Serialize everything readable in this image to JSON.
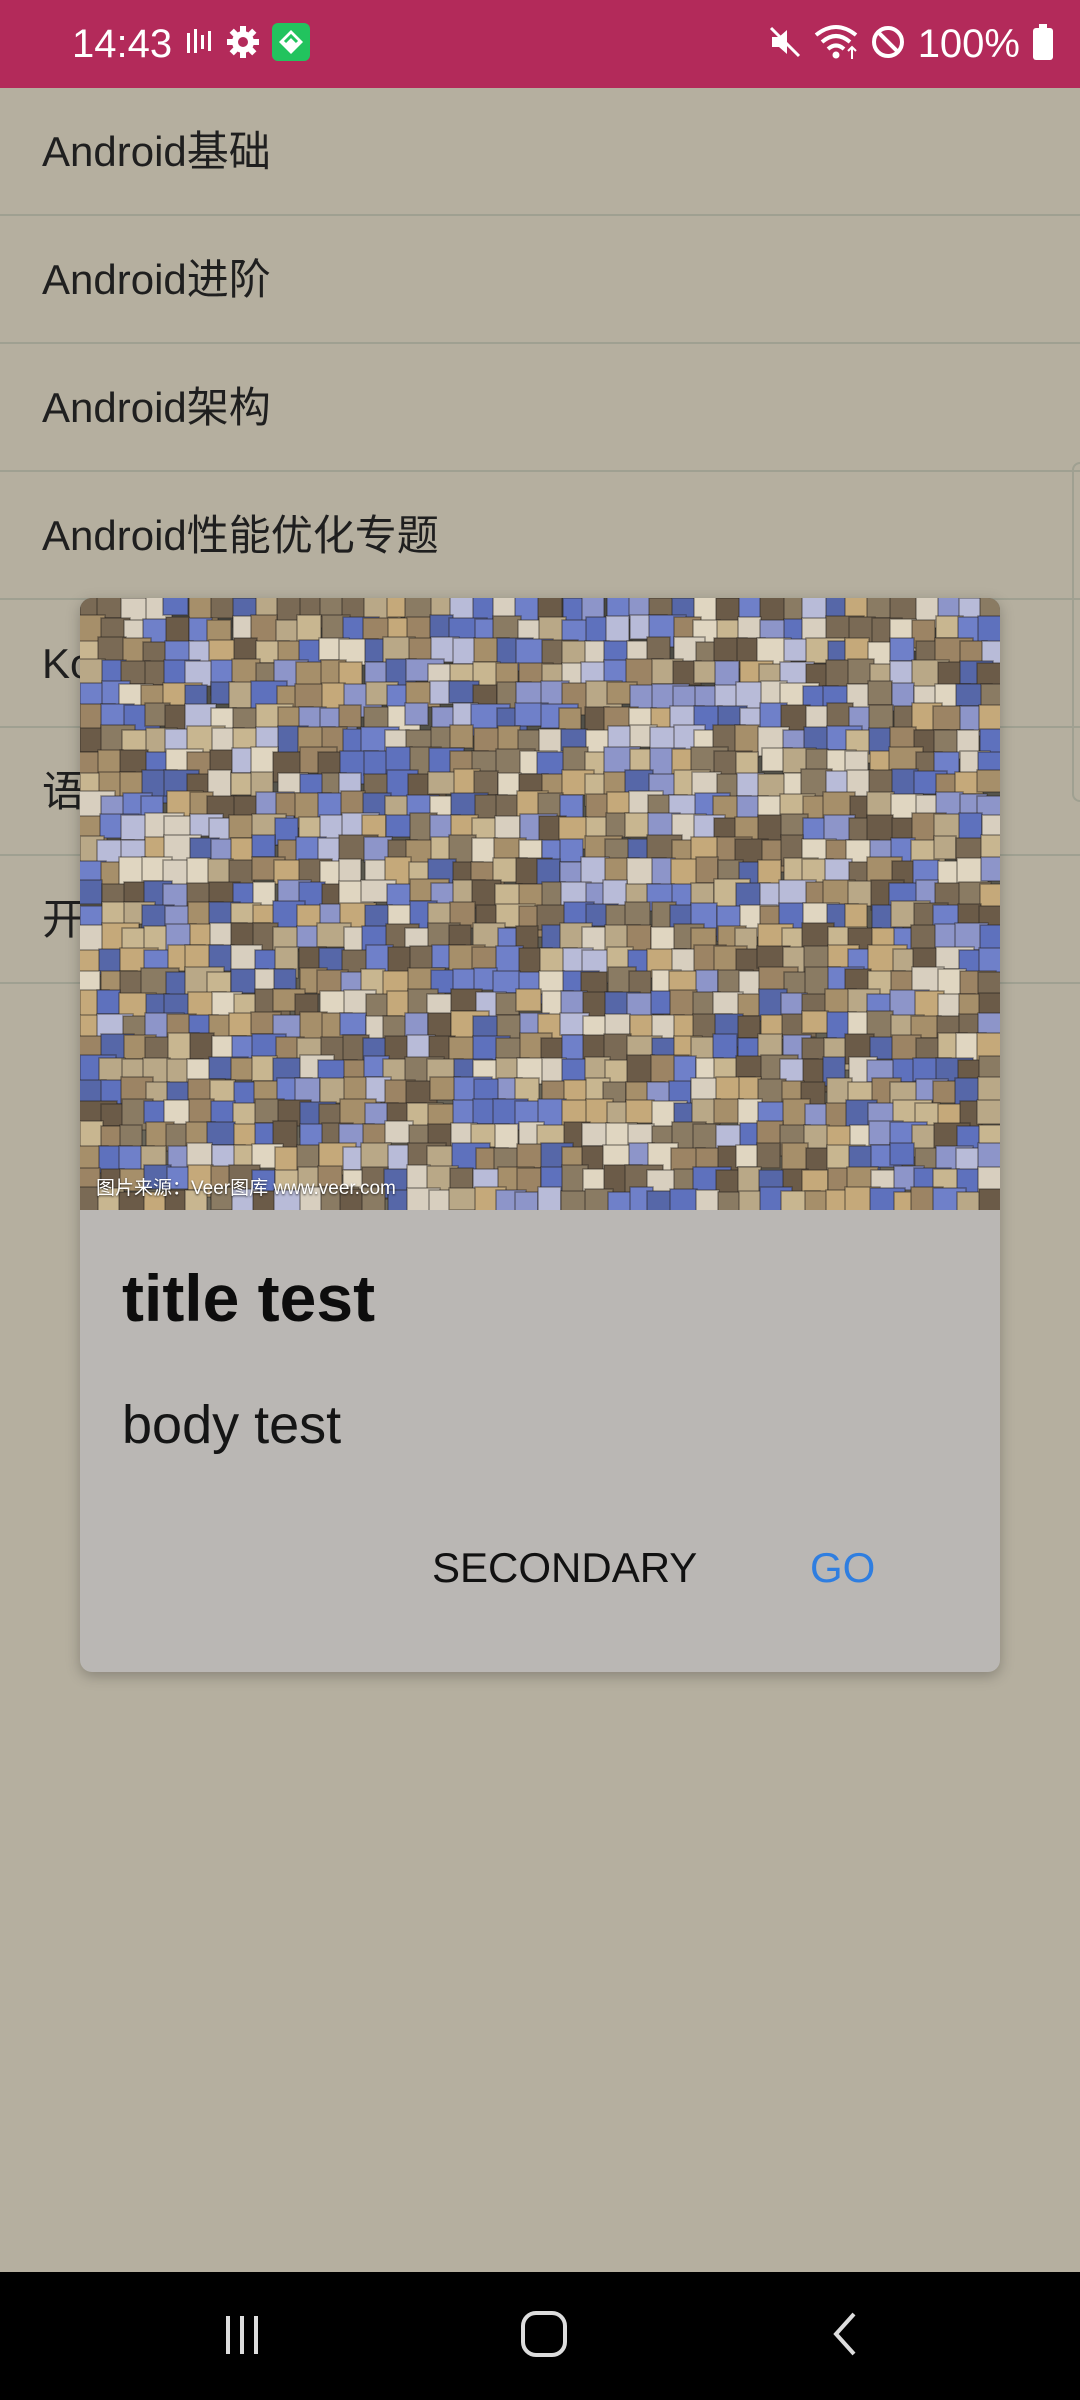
{
  "status_bar": {
    "time": "14:43",
    "left_icons": [
      "audio-bars-icon",
      "settings-gear-icon",
      "app-notification-icon"
    ],
    "right_icons": [
      "mute-icon",
      "wifi-icon",
      "do-not-disturb-icon",
      "battery-icon"
    ],
    "battery": "100%",
    "bg_color": "#b32a5a"
  },
  "list": {
    "items": [
      {
        "label": "Android基础"
      },
      {
        "label": "Android进阶"
      },
      {
        "label": "Android架构"
      },
      {
        "label": "Android性能优化专题"
      },
      {
        "label": "Ko"
      },
      {
        "label": "语"
      },
      {
        "label": "开"
      }
    ]
  },
  "dialog": {
    "image_credit": "图片来源：Veer图库 www.veer.com",
    "title": "title test",
    "body": "body test",
    "secondary_label": "SECONDARY",
    "go_label": "GO",
    "accent_color": "#2f7ee0"
  },
  "nav_bar": {
    "buttons": [
      "recent-apps-icon",
      "home-icon",
      "back-icon"
    ]
  }
}
